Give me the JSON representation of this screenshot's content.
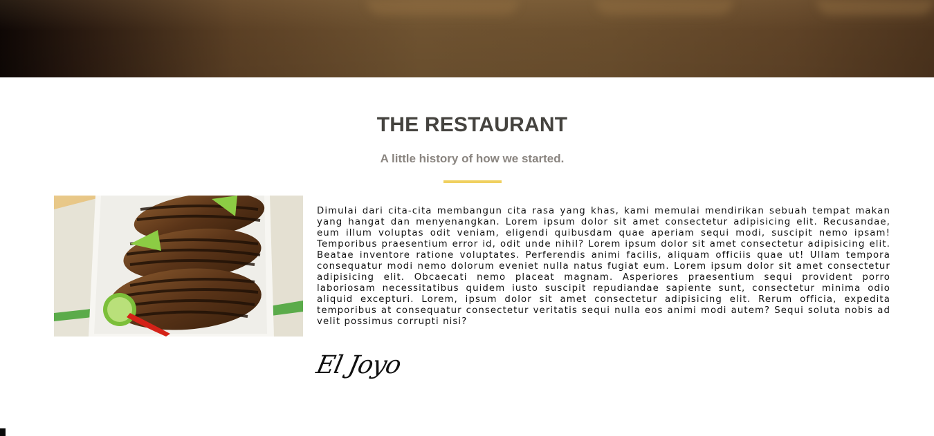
{
  "section": {
    "title": "THE RESTAURANT",
    "subtitle": "A little history of how we started.",
    "story": "Dimulai dari cita-cita membangun cita rasa yang khas, kami memulai mendirikan sebuah tempat makan yang hangat dan menyenangkan. Lorem ipsum dolor sit amet consectetur adipisicing elit. Recusandae, eum illum voluptas odit veniam, eligendi quibusdam quae aperiam sequi modi, suscipit nemo ipsam! Temporibus praesentium error id, odit unde nihil? Lorem ipsum dolor sit amet consectetur adipisicing elit. Beatae inventore ratione voluptates. Perferendis animi facilis, aliquam officiis quae ut! Ullam tempora consequatur modi nemo dolorum eveniet nulla natus fugiat eum. Lorem ipsum dolor sit amet consectetur adipisicing elit. Obcaecati nemo placeat magnam. Asperiores praesentium sequi provident porro laboriosam necessitatibus quidem iusto suscipit repudiandae sapiente sunt, consectetur minima odio aliquid excepturi. Lorem, ipsum dolor sit amet consectetur adipisicing elit. Rerum officia, expedita temporibus at consequatur consectetur veritatis sequi nulla eos animi modi autem? Sequi soluta nobis ad velit possimus corrupti nisi?",
    "signature": "El Joyo"
  },
  "colors": {
    "title": "#45433f",
    "subtitle": "#8a8580",
    "divider": "#f0d060",
    "body_text": "#111111"
  }
}
